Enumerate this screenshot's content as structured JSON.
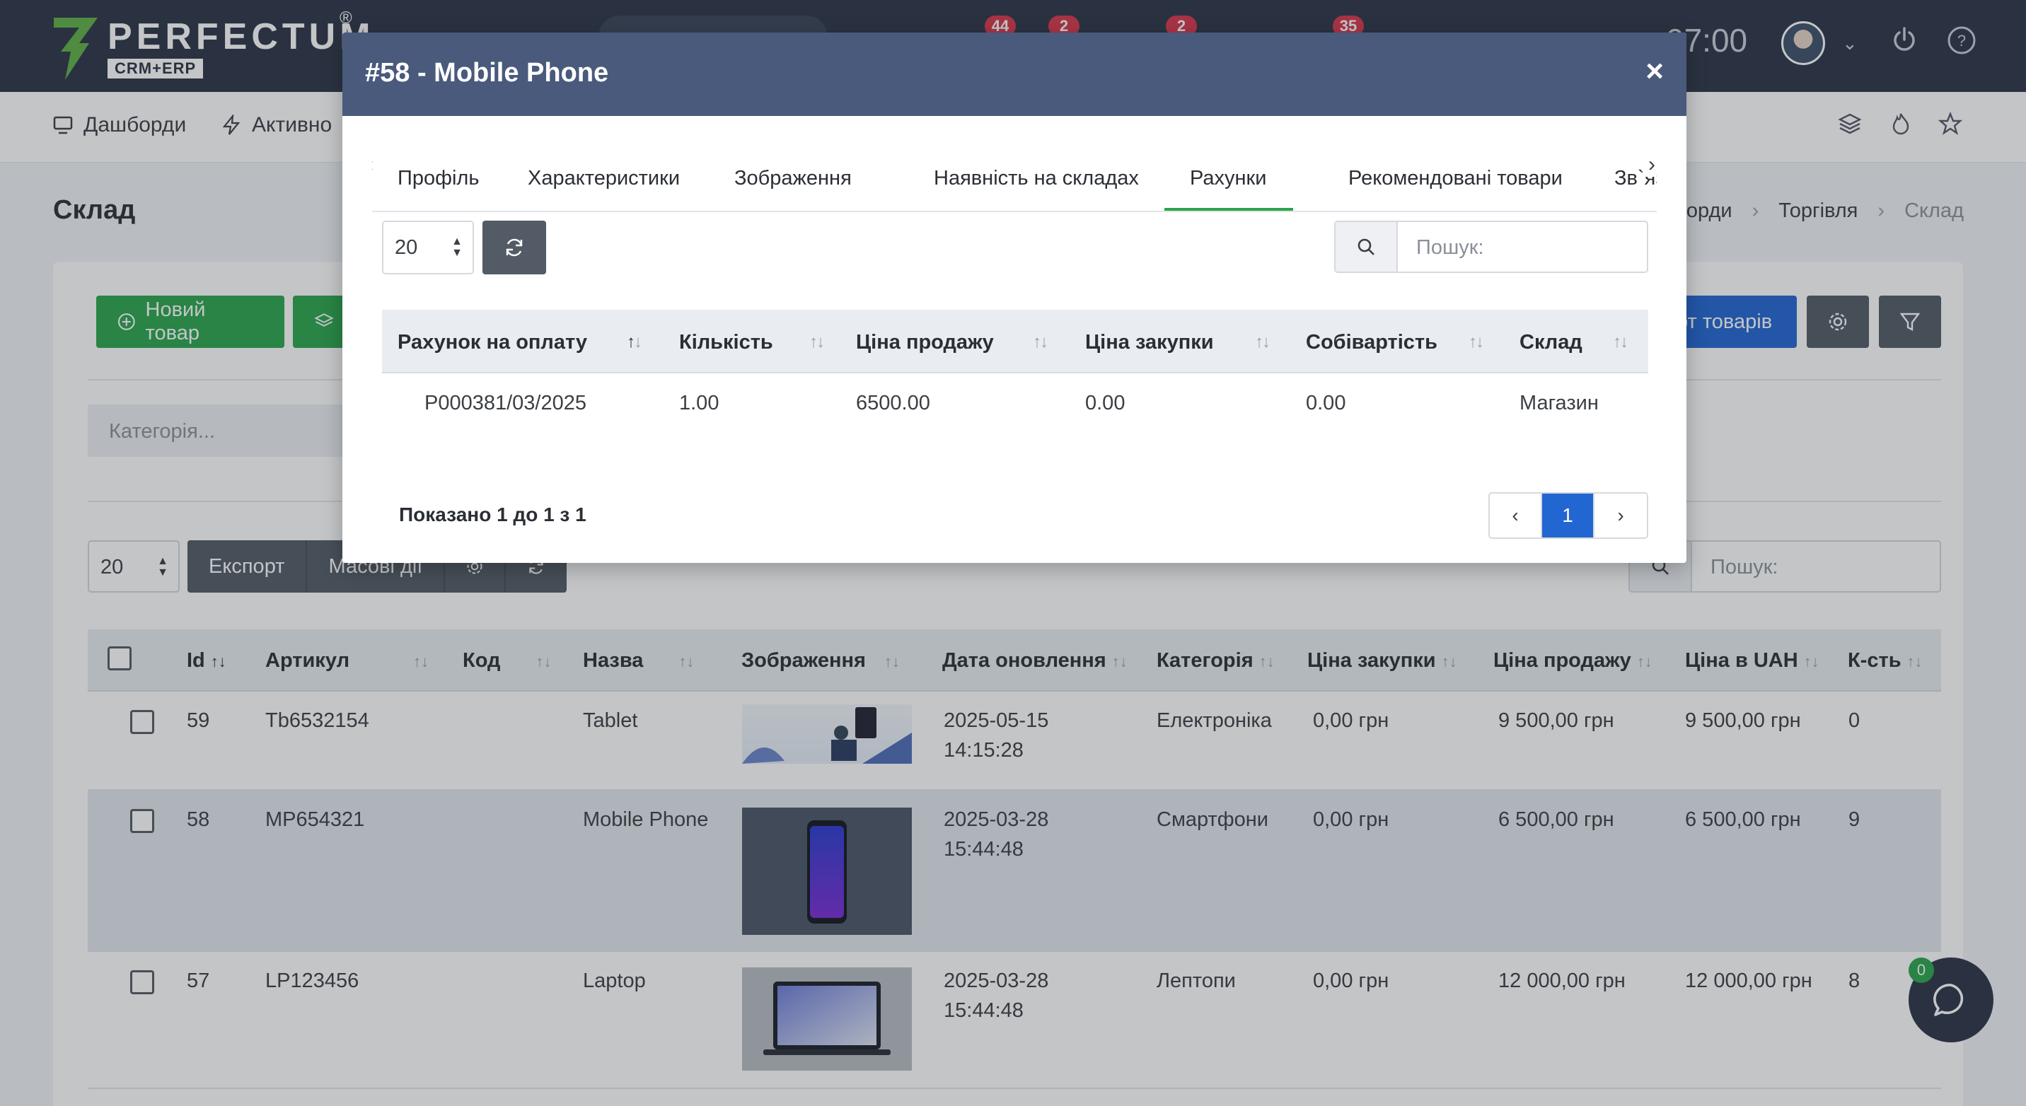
{
  "app": {
    "logo_text": "PERFECTUM",
    "logo_sub": "CRM+ERP",
    "logo_reg": "®",
    "clock": "07:00",
    "badges": [
      "44",
      "2",
      "2",
      "35"
    ]
  },
  "nav": {
    "items": [
      "Дашборди",
      "Активно"
    ]
  },
  "page": {
    "title": "Склад",
    "breadcrumb": [
      "ашборди",
      "Торгівля",
      "Склад"
    ]
  },
  "toolbar": {
    "new_product": "Новий товар",
    "import_products": "рт товарів",
    "category_placeholder": "Категорія...",
    "length_value": "20",
    "export": "Експорт",
    "bulk_actions": "Масові дії",
    "search_placeholder": "Пошук:"
  },
  "table": {
    "columns": [
      "Id",
      "Артикул",
      "Код",
      "Назва",
      "Зображення",
      "Дата оновлення",
      "Категорія",
      "Ціна закупки",
      "Ціна продажу",
      "Ціна в UAH",
      "К-сть"
    ],
    "rows": [
      {
        "id": "59",
        "sku": "Tb6532154",
        "code": "",
        "name": "Tablet",
        "date": "2025-05-15",
        "time": "14:15:28",
        "category": "Електроніка",
        "purchase": "0,00 грн",
        "sale": "9 500,00 грн",
        "uah": "9 500,00 грн",
        "qty": "0"
      },
      {
        "id": "58",
        "sku": "MP654321",
        "code": "",
        "name": "Mobile Phone",
        "date": "2025-03-28",
        "time": "15:44:48",
        "category": "Смартфони",
        "purchase": "0,00 грн",
        "sale": "6 500,00 грн",
        "uah": "6 500,00 грн",
        "qty": "9"
      },
      {
        "id": "57",
        "sku": "LP123456",
        "code": "",
        "name": "Laptop",
        "date": "2025-03-28",
        "time": "15:44:48",
        "category": "Лептопи",
        "purchase": "0,00 грн",
        "sale": "12 000,00 грн",
        "uah": "12 000,00 грн",
        "qty": "8"
      }
    ]
  },
  "chat": {
    "badge": "0"
  },
  "modal": {
    "title": "#58 - Mobile Phone",
    "close": "×",
    "tabs": [
      "Профіль",
      "Характеристики",
      "Зображення",
      "Наявність на складах",
      "Рахунки",
      "Рекомендовані товари",
      "Зв`язані то"
    ],
    "active_tab": "Рахунки",
    "length_value": "20",
    "search_placeholder": "Пошук:",
    "columns": [
      "Рахунок на оплату",
      "Кількість",
      "Ціна продажу",
      "Ціна закупки",
      "Собівартість",
      "Склад"
    ],
    "rows": [
      {
        "invoice": "P000381/03/2025",
        "qty": "1.00",
        "sale": "6500.00",
        "purchase": "0.00",
        "cost": "0.00",
        "warehouse": "Магазин"
      }
    ],
    "info": "Показано 1 до 1 з 1",
    "pager": {
      "prev": "‹",
      "current": "1",
      "next": "›"
    }
  },
  "colors": {
    "topbar": "#2b3446",
    "modal_header": "#4a5a7c",
    "accent_green": "#2aa54b",
    "accent_blue": "#2266d1",
    "link": "#1d5fb0"
  }
}
